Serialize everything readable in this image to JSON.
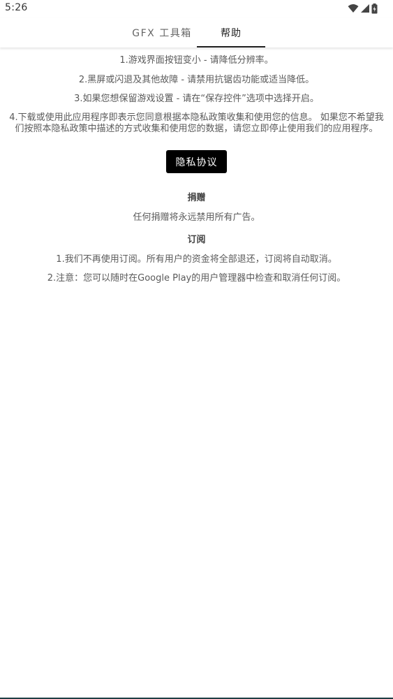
{
  "status_bar": {
    "time": "5:26",
    "icons": [
      "wifi-icon",
      "cell-signal-icon",
      "battery-icon"
    ]
  },
  "tabs": {
    "gfx_label": "GFX 工具箱",
    "help_label": "帮助",
    "active": "帮助"
  },
  "help": {
    "line1": "1.游戏界面按钮变小 - 请降低分辨率。",
    "line2": "2.黑屏或闪退及其他故障 - 请禁用抗锯齿功能或适当降低。",
    "line3": "3.如果您想保留游戏设置 - 请在“保存控件”选项中选择开启。",
    "line4": "4.下载或使用此应用程序即表示您同意根据本隐私政策收集和使用您的信息。 如果您不希望我们按照本隐私政策中描述的方式收集和使用您的数据，请您立即停止使用我们的应用程序。"
  },
  "privacy_button": "隐私协议",
  "donation": {
    "title": "捐赠",
    "text": "任何捐赠将永远禁用所有广告。"
  },
  "subscription": {
    "title": "订阅",
    "line1": "1.我们不再使用订阅。所有用户的资金将全部退还，订阅将自动取消。",
    "line2": "2.注意：您可以随时在Google Play的用户管理器中检查和取消任何订阅。"
  }
}
